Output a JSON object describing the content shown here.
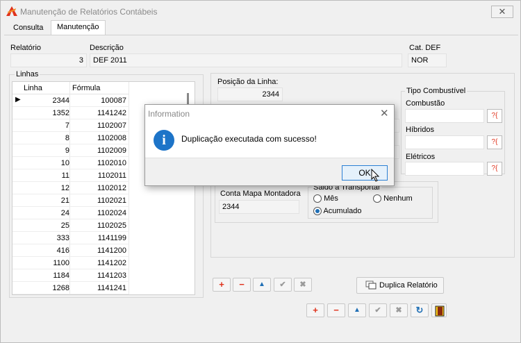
{
  "window": {
    "title": "Manutenção de Relatórios Contábeis",
    "close_glyph": "✕"
  },
  "tabs": [
    {
      "label": "Consulta",
      "active": false
    },
    {
      "label": "Manutenção",
      "active": true
    }
  ],
  "header": {
    "relatorio_label": "Relatório",
    "relatorio_value": "3",
    "descricao_label": "Descrição",
    "descricao_value": "DEF 2011",
    "catdef_label": "Cat. DEF",
    "catdef_value": "NOR"
  },
  "linhas": {
    "group_label": "Linhas",
    "columns": [
      "Linha",
      "Fórmula"
    ],
    "rows": [
      {
        "linha": "2344",
        "formula": "100087",
        "current": true
      },
      {
        "linha": "1352",
        "formula": "1141242"
      },
      {
        "linha": "7",
        "formula": "1102007"
      },
      {
        "linha": "8",
        "formula": "1102008"
      },
      {
        "linha": "9",
        "formula": "1102009"
      },
      {
        "linha": "10",
        "formula": "1102010"
      },
      {
        "linha": "11",
        "formula": "1102011"
      },
      {
        "linha": "12",
        "formula": "1102012"
      },
      {
        "linha": "21",
        "formula": "1102021"
      },
      {
        "linha": "24",
        "formula": "1102024"
      },
      {
        "linha": "25",
        "formula": "1102025"
      },
      {
        "linha": "333",
        "formula": "1141199"
      },
      {
        "linha": "416",
        "formula": "1141200"
      },
      {
        "linha": "1100",
        "formula": "1141202"
      },
      {
        "linha": "1184",
        "formula": "1141203"
      },
      {
        "linha": "1268",
        "formula": "1141241"
      }
    ]
  },
  "detail": {
    "posicao_label": "Posição da Linha:",
    "posicao_value": "2344",
    "conta_mapa_label": "Conta Mapa Montadora",
    "conta_mapa_value": "2344",
    "saldo_label": "Saldo a Transportar",
    "saldo_options": [
      {
        "label": "Mês",
        "selected": false
      },
      {
        "label": "Nenhum",
        "selected": false
      },
      {
        "label": "Acumulado",
        "selected": true
      }
    ]
  },
  "tipo_combustivel": {
    "group_label": "Tipo Combustível",
    "combustao_label": "Combustão",
    "hibridos_label": "Híbridos",
    "eletricos_label": "Elétricos",
    "lookup_glyph": "?{"
  },
  "detail_toolbar": {
    "add": "+",
    "remove": "−",
    "up": "▲",
    "confirm": "✔",
    "cancel": "✖",
    "duplicate_label": "Duplica Relatório"
  },
  "main_toolbar": {
    "add": "+",
    "remove": "−",
    "up": "▲",
    "confirm": "✔",
    "cancel": "✖",
    "refresh": "↻"
  },
  "dialog": {
    "title": "Information",
    "close_glyph": "✕",
    "icon_glyph": "i",
    "message": "Duplicação executada com sucesso!",
    "ok_label": "OK"
  },
  "colors": {
    "accent_red": "#e0321c",
    "accent_blue": "#1f6fb5",
    "info_blue": "#1d74c8"
  }
}
